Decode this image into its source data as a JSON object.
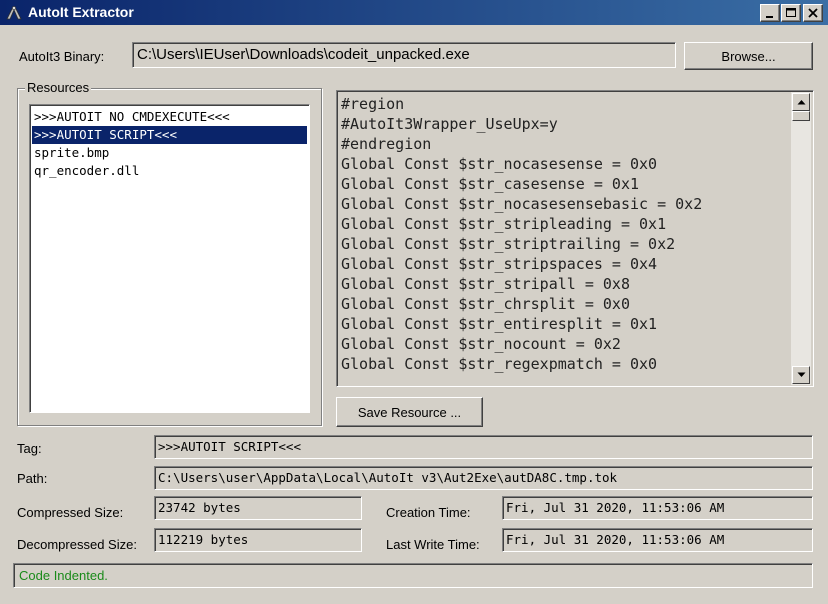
{
  "window": {
    "title": "AutoIt Extractor",
    "icon": "autoit-app-icon"
  },
  "binary": {
    "label": "AutoIt3 Binary:",
    "value": "C:\\Users\\IEUser\\Downloads\\codeit_unpacked.exe",
    "browse_label": "Browse..."
  },
  "resources": {
    "title": "Resources",
    "items": [
      {
        "label": ">>>AUTOIT NO CMDEXECUTE<<<",
        "selected": false
      },
      {
        "label": ">>>AUTOIT SCRIPT<<<",
        "selected": true
      },
      {
        "label": "sprite.bmp",
        "selected": false
      },
      {
        "label": "qr_encoder.dll",
        "selected": false
      }
    ]
  },
  "code": {
    "lines": [
      "#region",
      "#AutoIt3Wrapper_UseUpx=y",
      "#endregion",
      "Global Const $str_nocasesense = 0x0",
      "Global Const $str_casesense = 0x1",
      "Global Const $str_nocasesensebasic = 0x2",
      "Global Const $str_stripleading = 0x1",
      "Global Const $str_striptrailing = 0x2",
      "Global Const $str_stripspaces = 0x4",
      "Global Const $str_stripall = 0x8",
      "Global Const $str_chrsplit = 0x0",
      "Global Const $str_entiresplit = 0x1",
      "Global Const $str_nocount = 0x2",
      "Global Const $str_regexpmatch = 0x0"
    ]
  },
  "save_resource_label": "Save Resource ...",
  "details": {
    "tag_label": "Tag:",
    "tag_value": ">>>AUTOIT SCRIPT<<<",
    "path_label": "Path:",
    "path_value": "C:\\Users\\user\\AppData\\Local\\AutoIt v3\\Aut2Exe\\autDA8C.tmp.tok",
    "compressed_label": "Compressed Size:",
    "compressed_value": "23742 bytes",
    "decompressed_label": "Decompressed Size:",
    "decompressed_value": "112219 bytes",
    "creation_label": "Creation Time:",
    "creation_value": "Fri, Jul 31 2020, 11:53:06 AM",
    "lastwrite_label": "Last Write Time:",
    "lastwrite_value": "Fri, Jul 31 2020, 11:53:06 AM"
  },
  "status": {
    "text": "Code Indented.",
    "color": "#1a8a1a"
  },
  "colors": {
    "title_start": "#0a246a",
    "title_end": "#3a6ea5",
    "selection": "#0a246a",
    "face": "#d4d0c8"
  }
}
